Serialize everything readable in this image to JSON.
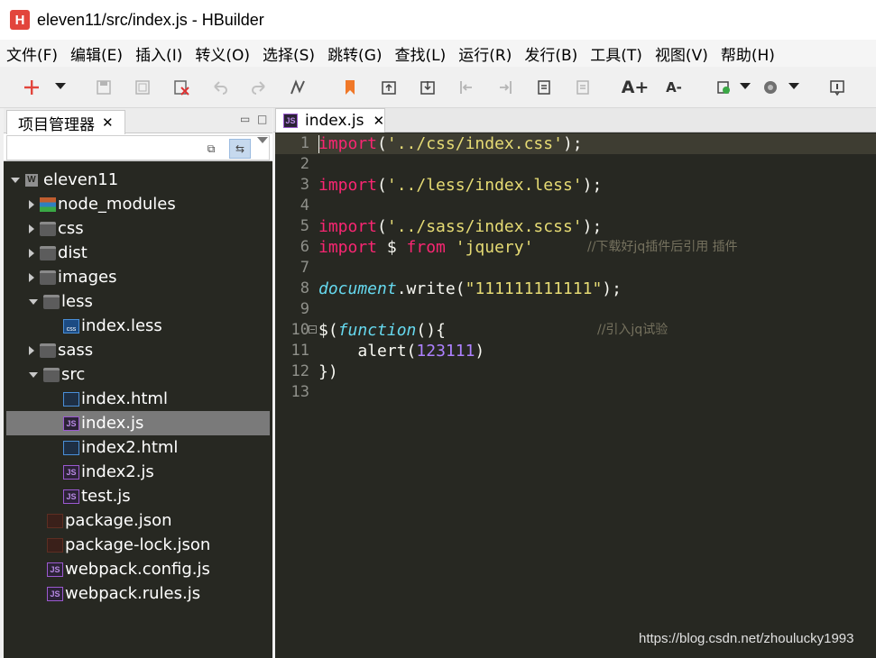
{
  "window": {
    "title": "eleven11/src/index.js  -  HBuilder",
    "logo": "H"
  },
  "menu": [
    "文件(F)",
    "编辑(E)",
    "插入(I)",
    "转义(O)",
    "选择(S)",
    "跳转(G)",
    "查找(L)",
    "运行(R)",
    "发行(B)",
    "工具(T)",
    "视图(V)",
    "帮助(H)"
  ],
  "toolbar": {
    "icons": [
      "new-file-icon",
      "save-icon",
      "save-all-icon",
      "close-file-icon",
      "undo-icon",
      "redo-icon",
      "format-icon",
      "bookmark-icon",
      "goto-icon",
      "download-icon",
      "jump-start-icon",
      "jump-end-icon",
      "copy-icon",
      "paste-icon",
      "font-increase-icon",
      "font-decrease-icon",
      "run-icon",
      "browser-icon",
      "help-icon"
    ],
    "font_up": "A+",
    "font_down": "A-"
  },
  "project_panel": {
    "tab_label": "项目管理器",
    "close": "✕",
    "tree": [
      {
        "label": "eleven11",
        "type": "project",
        "expanded": true,
        "level": 0
      },
      {
        "label": "node_modules",
        "type": "modules",
        "level": 1
      },
      {
        "label": "css",
        "type": "folder",
        "level": 1
      },
      {
        "label": "dist",
        "type": "folder",
        "level": 1
      },
      {
        "label": "images",
        "type": "folder",
        "level": 1
      },
      {
        "label": "less",
        "type": "folder",
        "expanded": true,
        "level": 1
      },
      {
        "label": "index.less",
        "type": "css",
        "level": 2
      },
      {
        "label": "sass",
        "type": "folder",
        "level": 1
      },
      {
        "label": "src",
        "type": "folder",
        "expanded": true,
        "level": 1
      },
      {
        "label": "index.html",
        "type": "html",
        "level": 2
      },
      {
        "label": "index.js",
        "type": "js",
        "level": 2,
        "selected": true
      },
      {
        "label": "index2.html",
        "type": "html",
        "level": 2
      },
      {
        "label": "index2.js",
        "type": "js",
        "level": 2
      },
      {
        "label": "test.js",
        "type": "js",
        "level": 2
      },
      {
        "label": "package.json",
        "type": "json",
        "level": 1
      },
      {
        "label": "package-lock.json",
        "type": "json",
        "level": 1
      },
      {
        "label": "webpack.config.js",
        "type": "js",
        "level": 1
      },
      {
        "label": "webpack.rules.js",
        "type": "js",
        "level": 1
      }
    ]
  },
  "editor": {
    "tab_label": "index.js",
    "tab_icon": "JS",
    "close": "✕",
    "line_numbers": [
      "1",
      "2",
      "3",
      "4",
      "5",
      "6",
      "7",
      "8",
      "9",
      "10",
      "11",
      "12",
      "13"
    ],
    "lines": {
      "l1": {
        "kw": "import",
        "p1": "(",
        "str": "'../css/index.css'",
        "p2": ");"
      },
      "l3": {
        "kw": "import",
        "p1": "(",
        "str": "'../less/index.less'",
        "p2": ");"
      },
      "l5": {
        "kw": "import",
        "p1": "(",
        "str": "'../sass/index.scss'",
        "p2": ");"
      },
      "l6": {
        "kw": "import",
        "mid": " $ ",
        "kw2": "from",
        "sp": " ",
        "str": "'jquery'",
        "cmt": "//下载好jq插件后引用 插件"
      },
      "l8": {
        "obj": "document",
        "rest": ".write(",
        "str": "\"111111111111\"",
        "p2": ");"
      },
      "l10": {
        "head": "$(",
        "fn": "function",
        "rest": "(){",
        "cmt": "//引入jq试验"
      },
      "l11": {
        "indent": "    ",
        "call": "alert(",
        "num": "123111",
        "p2": ")"
      },
      "l12": {
        "text": "})"
      }
    }
  },
  "watermark": "https://blog.csdn.net/zhoulucky1993",
  "colors": {
    "editor_bg": "#272822",
    "keyword": "#f92672",
    "string": "#e6db74",
    "number": "#ae81ff",
    "comment": "#75715e",
    "builtin": "#66d9ef",
    "selection": "#7a7a7a"
  }
}
